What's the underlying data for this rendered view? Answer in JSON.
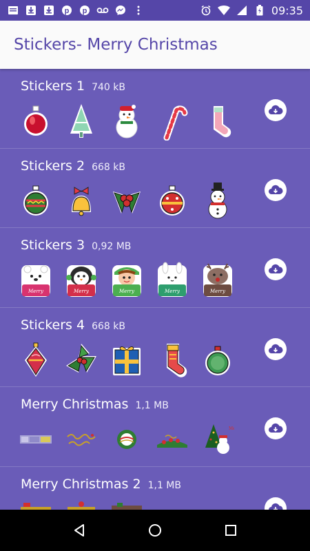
{
  "status_bar": {
    "time": "09:35",
    "icons_left": [
      "message-icon",
      "download-icon",
      "download-icon",
      "pinterest-icon",
      "pinterest-icon",
      "voicemail-icon",
      "messenger-icon",
      "more-icon"
    ],
    "icons_right": [
      "alarm-icon",
      "wifi-icon",
      "signal-icon",
      "battery-charging-icon"
    ]
  },
  "app_bar": {
    "title": "Stickers- Merry Christmas"
  },
  "packs": [
    {
      "name": "Stickers 1",
      "size": "740 kB",
      "stickers": [
        "ornament-red",
        "tree",
        "snowman",
        "candy-cane",
        "stocking-pink"
      ]
    },
    {
      "name": "Stickers 2",
      "size": "668 kB",
      "stickers": [
        "ornament-green",
        "bells",
        "holly",
        "ornament-red-dots",
        "snowman-hat"
      ]
    },
    {
      "name": "Stickers 3",
      "size": "0,92 MB",
      "stickers": [
        "bear-merry",
        "penguin-merry",
        "elf-merry",
        "bunny-merry",
        "reindeer-merry"
      ]
    },
    {
      "name": "Stickers 4",
      "size": "668 kB",
      "stickers": [
        "ornament-red-ruby",
        "holly-leaves",
        "gift-box",
        "stocking-red",
        "ornament-green-bow"
      ]
    },
    {
      "name": "Merry Christmas",
      "size": "1,1 MB",
      "stickers": [
        "gif-1",
        "gif-2",
        "gif-3",
        "gif-4",
        "gif-5"
      ]
    },
    {
      "name": "Merry Christmas 2",
      "size": "1,1 MB",
      "stickers": [
        "gif-6",
        "gif-7",
        "gif-8"
      ]
    }
  ],
  "colors": {
    "accent": "#5546a8",
    "background": "#6a5cb8",
    "appbar": "#fafafa"
  },
  "nav": [
    "back-icon",
    "home-icon",
    "recents-icon"
  ]
}
